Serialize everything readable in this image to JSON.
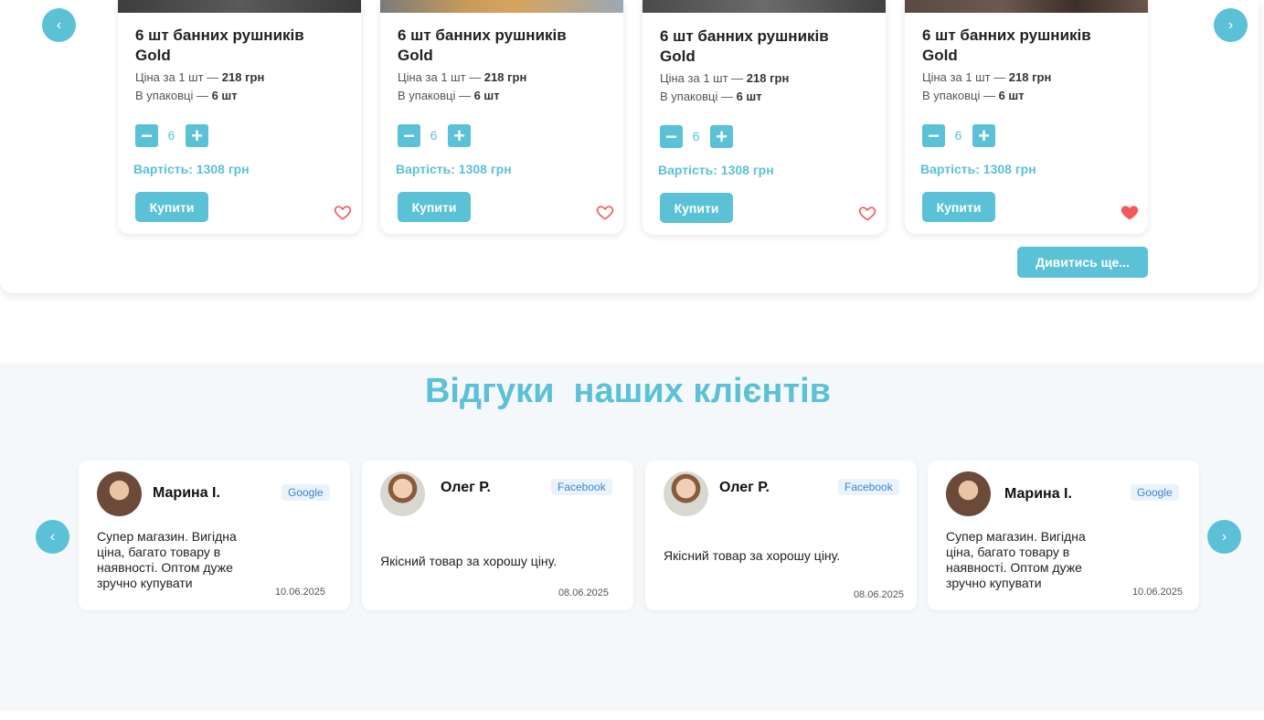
{
  "products": {
    "prev_icon": "‹",
    "next_icon": "›",
    "items": [
      {
        "name": "6 шт банних рушників Gold",
        "price_label": "Ціна за 1 шт — ",
        "price_value": "218 грн",
        "pack_label": "В упаковці — ",
        "pack_value": "6 шт",
        "qty": "6",
        "total": "Вартість: 1308 грн",
        "buy_label": "Купити",
        "favorite": false,
        "image_style": "dark"
      },
      {
        "name": "6 шт банних рушників Gold",
        "price_label": "Ціна за 1 шт — ",
        "price_value": "218 грн",
        "pack_label": "В упаковці — ",
        "pack_value": "6 шт",
        "qty": "6",
        "total": "Вартість: 1308 грн",
        "buy_label": "Купити",
        "favorite": false,
        "image_style": "wood"
      },
      {
        "name": "6 шт банних рушників Gold",
        "price_label": "Ціна за 1 шт — ",
        "price_value": "218 грн",
        "pack_label": "В упаковці — ",
        "pack_value": "6 шт",
        "qty": "6",
        "total": "Вартість: 1308 грн",
        "buy_label": "Купити",
        "favorite": false,
        "image_style": "slate"
      },
      {
        "name": "6 шт банних рушників Gold",
        "price_label": "Ціна за 1 шт — ",
        "price_value": "218 грн",
        "pack_label": "В упаковці — ",
        "pack_value": "6 шт",
        "qty": "6",
        "total": "Вартість: 1308 грн",
        "buy_label": "Купити",
        "favorite": true,
        "image_style": "brick"
      }
    ],
    "minus_icon": "−",
    "plus_icon": "+",
    "more_label": "Дивитись ще..."
  },
  "reviews": {
    "title": "Відгуки  наших клієнтів",
    "prev_icon": "‹",
    "next_icon": "›",
    "items": [
      {
        "name": "Марина І.",
        "source": "Google",
        "text": "Супер магазин. Вигідна ціна, багато товару в наявності. Оптом дуже зручно купувати",
        "date": "10.06.2025",
        "avatar": "woman"
      },
      {
        "name": "Олег Р.",
        "source": "Facebook",
        "text": "Якісний товар за хорошу ціну.",
        "date": "08.06.2025",
        "avatar": "man"
      },
      {
        "name": "Олег Р.",
        "source": "Facebook",
        "text": "Якісний товар за хорошу ціну.",
        "date": "08.06.2025",
        "avatar": "man"
      },
      {
        "name": "Марина І.",
        "source": "Google",
        "text": "Супер магазин. Вигідна ціна, багато товару в наявності. Оптом дуже зручно купувати",
        "date": "10.06.2025",
        "avatar": "woman"
      }
    ]
  },
  "colors": {
    "accent": "#5ac1d6",
    "heart": "#f05a5a",
    "badge_text": "#3c86c9"
  }
}
